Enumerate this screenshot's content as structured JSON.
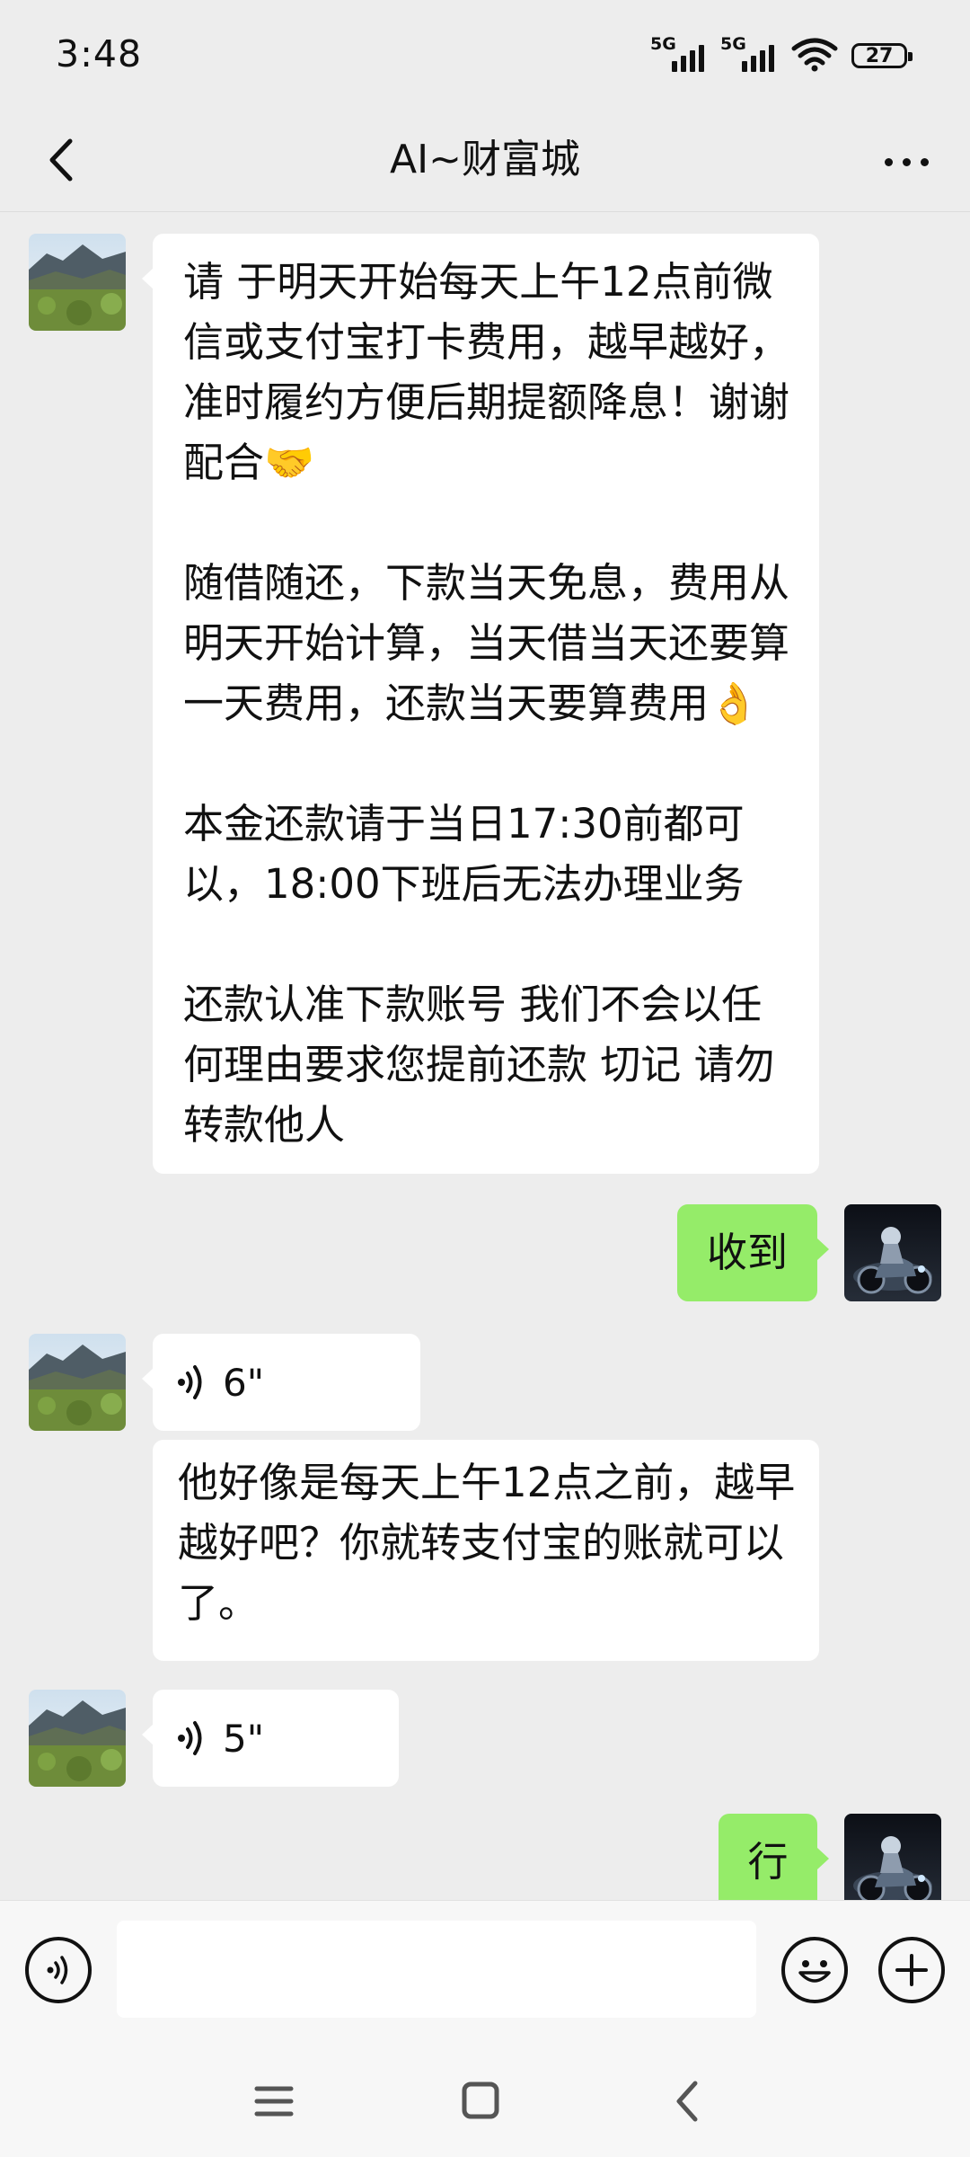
{
  "status_bar": {
    "time": "3:48",
    "signal1_label": "5G",
    "signal2_label": "5G",
    "battery": "27"
  },
  "nav": {
    "title": "AI~财富城"
  },
  "messages": {
    "m1": {
      "p1": "请 于明天开始每天上午12点前微信或支付宝打卡费用，越早越好，准时履约方便后期提额降息！谢谢配合🤝",
      "p2": "随借随还，下款当天免息，费用从明天开始计算，当天借当天还要算一天费用，还款当天要算费用👌",
      "p3": "本金还款请于当日17:30前都可以，18:00下班后无法办理业务",
      "p4": "还款认准下款账号 我们不会以任何理由要求您提前还款 切记 请勿转款他人"
    },
    "m2": {
      "text": "收到"
    },
    "m3": {
      "duration": "6\""
    },
    "m4": {
      "text": "他好像是每天上午12点之前，越早越好吧？你就转支付宝的账就可以了。"
    },
    "m5": {
      "duration": "5\""
    },
    "m6": {
      "text": "行"
    }
  },
  "input": {
    "placeholder": ""
  },
  "icons": {
    "back": "chevron-left-icon",
    "more": "more-dots-icon",
    "voice": "voice-icon",
    "emoji": "emoji-icon",
    "add": "plus-icon"
  },
  "colors": {
    "outgoing_bubble": "#95ec69",
    "incoming_bubble": "#ffffff",
    "background": "#ededed"
  }
}
